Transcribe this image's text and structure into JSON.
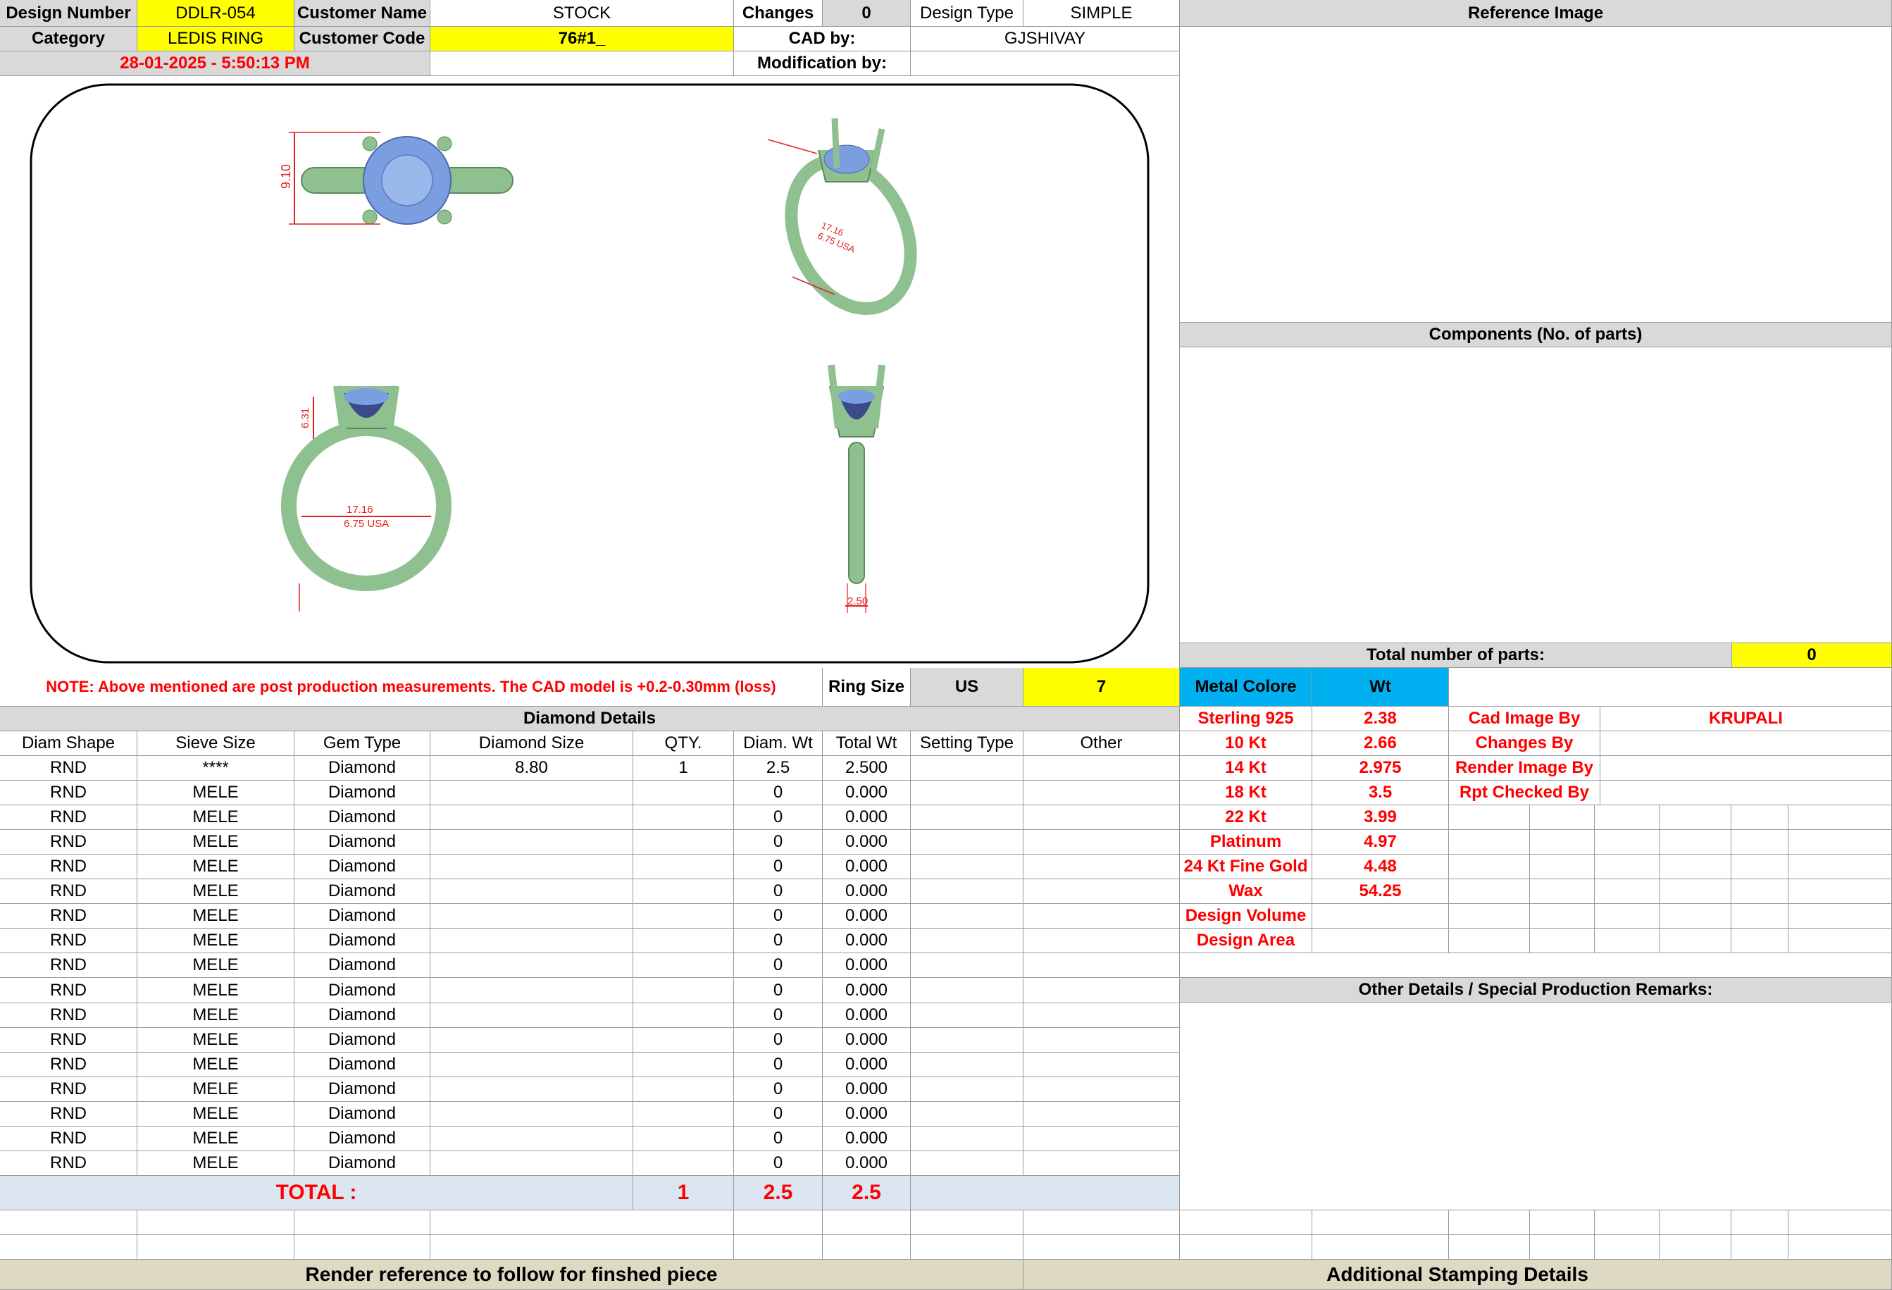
{
  "header": {
    "design_number_label": "Design Number",
    "design_number": "DDLR-054",
    "customer_name_label": "Customer Name",
    "customer_name": "STOCK",
    "changes_label": "Changes",
    "changes": "0",
    "design_type_label": "Design Type",
    "design_type": "SIMPLE",
    "reference_image_label": "Reference Image",
    "category_label": "Category",
    "category": "LEDIS RING",
    "customer_code_label": "Customer Code",
    "customer_code": "76#1_",
    "cad_by_label": "CAD by:",
    "cad_by": "GJSHIVAY",
    "timestamp": "28-01-2025 - 5:50:13 PM",
    "modification_by_label": "Modification by:"
  },
  "drawing": {
    "dim_top_height": "9.10",
    "dim_front_height": "6.31",
    "dim_inner": "17.16",
    "dim_inner_us": "6.75 USA",
    "dim_side_width": "2.50",
    "dim_persp_a": "17.16",
    "dim_persp_b": "6.75 USA"
  },
  "components": {
    "title": "Components (No. of parts)",
    "total_label": "Total number of parts:",
    "total_value": "0"
  },
  "note": "NOTE: Above mentioned are post production measurements. The CAD model is +0.2-0.30mm (loss)",
  "ring_size": {
    "label": "Ring Size",
    "unit": "US",
    "value": "7"
  },
  "metal": {
    "label": "Metal Colore",
    "wt_label": "Wt",
    "rows": [
      {
        "name": "Sterling 925",
        "wt": "2.38"
      },
      {
        "name": "10 Kt",
        "wt": "2.66"
      },
      {
        "name": "14 Kt",
        "wt": "2.975"
      },
      {
        "name": "18 Kt",
        "wt": "3.5"
      },
      {
        "name": "22 Kt",
        "wt": "3.99"
      },
      {
        "name": "Platinum",
        "wt": "4.97"
      },
      {
        "name": "24 Kt Fine Gold",
        "wt": "4.48"
      },
      {
        "name": "Wax",
        "wt": "54.25"
      },
      {
        "name": "Design Volume",
        "wt": ""
      },
      {
        "name": "Design Area",
        "wt": ""
      }
    ]
  },
  "staff": [
    {
      "label": "Cad Image By",
      "value": "KRUPALI"
    },
    {
      "label": "Changes By",
      "value": ""
    },
    {
      "label": "Render Image By",
      "value": ""
    },
    {
      "label": "Rpt Checked By",
      "value": ""
    }
  ],
  "diamond": {
    "title": "Diamond Details",
    "headers": [
      "Diam Shape",
      "Sieve Size",
      "Gem Type",
      "Diamond Size",
      "QTY.",
      "Diam. Wt",
      "Total Wt",
      "Setting Type",
      "Other"
    ],
    "rows": [
      [
        "RND",
        "****",
        "Diamond",
        "8.80",
        "1",
        "2.5",
        "2.500",
        "",
        ""
      ],
      [
        "RND",
        "MELE",
        "Diamond",
        "",
        "",
        "0",
        "0.000",
        "",
        ""
      ],
      [
        "RND",
        "MELE",
        "Diamond",
        "",
        "",
        "0",
        "0.000",
        "",
        ""
      ],
      [
        "RND",
        "MELE",
        "Diamond",
        "",
        "",
        "0",
        "0.000",
        "",
        ""
      ],
      [
        "RND",
        "MELE",
        "Diamond",
        "",
        "",
        "0",
        "0.000",
        "",
        ""
      ],
      [
        "RND",
        "MELE",
        "Diamond",
        "",
        "",
        "0",
        "0.000",
        "",
        ""
      ],
      [
        "RND",
        "MELE",
        "Diamond",
        "",
        "",
        "0",
        "0.000",
        "",
        ""
      ],
      [
        "RND",
        "MELE",
        "Diamond",
        "",
        "",
        "0",
        "0.000",
        "",
        ""
      ],
      [
        "RND",
        "MELE",
        "Diamond",
        "",
        "",
        "0",
        "0.000",
        "",
        ""
      ],
      [
        "RND",
        "MELE",
        "Diamond",
        "",
        "",
        "0",
        "0.000",
        "",
        ""
      ],
      [
        "RND",
        "MELE",
        "Diamond",
        "",
        "",
        "0",
        "0.000",
        "",
        ""
      ],
      [
        "RND",
        "MELE",
        "Diamond",
        "",
        "",
        "0",
        "0.000",
        "",
        ""
      ],
      [
        "RND",
        "MELE",
        "Diamond",
        "",
        "",
        "0",
        "0.000",
        "",
        ""
      ],
      [
        "RND",
        "MELE",
        "Diamond",
        "",
        "",
        "0",
        "0.000",
        "",
        ""
      ],
      [
        "RND",
        "MELE",
        "Diamond",
        "",
        "",
        "0",
        "0.000",
        "",
        ""
      ],
      [
        "RND",
        "MELE",
        "Diamond",
        "",
        "",
        "0",
        "0.000",
        "",
        ""
      ],
      [
        "RND",
        "MELE",
        "Diamond",
        "",
        "",
        "0",
        "0.000",
        "",
        ""
      ]
    ],
    "total_label": "TOTAL :",
    "total_qty": "1",
    "total_diam_wt": "2.5",
    "total_wt": "2.5"
  },
  "other_details_title": "Other Details / Special Production Remarks:",
  "footer": {
    "render_reference": "Render reference to follow for finshed piece",
    "stamping": "Additional Stamping Details"
  }
}
